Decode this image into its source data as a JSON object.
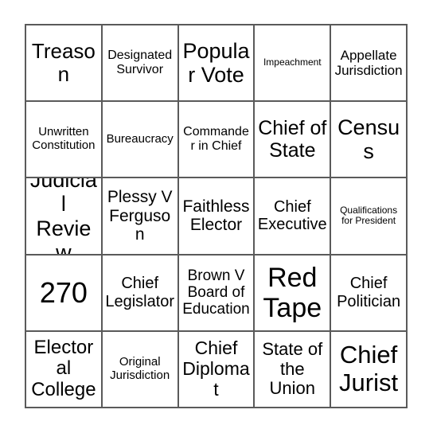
{
  "card": {
    "type": "bingo-card",
    "rows": 5,
    "columns": 5,
    "background_color": "#ffffff",
    "border_color": "#5a5a5a",
    "text_color": "#000000",
    "cells": [
      {
        "row": 1,
        "col": 1,
        "text": "Treason",
        "font_size": 26
      },
      {
        "row": 1,
        "col": 2,
        "text": "Designated Survivor",
        "font_size": 16
      },
      {
        "row": 1,
        "col": 3,
        "text": "Popular Vote",
        "font_size": 27
      },
      {
        "row": 1,
        "col": 4,
        "text": "Impeachment",
        "font_size": 12
      },
      {
        "row": 1,
        "col": 5,
        "text": "Appellate Jurisdiction",
        "font_size": 17
      },
      {
        "row": 2,
        "col": 1,
        "text": "Unwritten Constitution",
        "font_size": 15
      },
      {
        "row": 2,
        "col": 2,
        "text": "Bureaucracy",
        "font_size": 15
      },
      {
        "row": 2,
        "col": 3,
        "text": "Commander in Chief",
        "font_size": 16
      },
      {
        "row": 2,
        "col": 4,
        "text": "Chief of State",
        "font_size": 25
      },
      {
        "row": 2,
        "col": 5,
        "text": "Census",
        "font_size": 27
      },
      {
        "row": 3,
        "col": 1,
        "text": "Judicial Review",
        "font_size": 27
      },
      {
        "row": 3,
        "col": 2,
        "text": "Plessy V Ferguson",
        "font_size": 21
      },
      {
        "row": 3,
        "col": 3,
        "text": "Faithless Elector",
        "font_size": 21
      },
      {
        "row": 3,
        "col": 4,
        "text": "Chief Executive",
        "font_size": 20
      },
      {
        "row": 3,
        "col": 5,
        "text": "Qualifications for President",
        "font_size": 12
      },
      {
        "row": 4,
        "col": 1,
        "text": "270",
        "font_size": 36
      },
      {
        "row": 4,
        "col": 2,
        "text": "Chief Legislator",
        "font_size": 20
      },
      {
        "row": 4,
        "col": 3,
        "text": "Brown V Board of Education",
        "font_size": 19
      },
      {
        "row": 4,
        "col": 4,
        "text": "Red Tape",
        "font_size": 34
      },
      {
        "row": 4,
        "col": 5,
        "text": "Chief Politician",
        "font_size": 20
      },
      {
        "row": 5,
        "col": 1,
        "text": "Electoral College",
        "font_size": 24
      },
      {
        "row": 5,
        "col": 2,
        "text": "Original Jurisdiction",
        "font_size": 15
      },
      {
        "row": 5,
        "col": 3,
        "text": "Chief Diplomat",
        "font_size": 23
      },
      {
        "row": 5,
        "col": 4,
        "text": "State of the Union",
        "font_size": 22
      },
      {
        "row": 5,
        "col": 5,
        "text": "Chief Jurist",
        "font_size": 31
      }
    ]
  }
}
